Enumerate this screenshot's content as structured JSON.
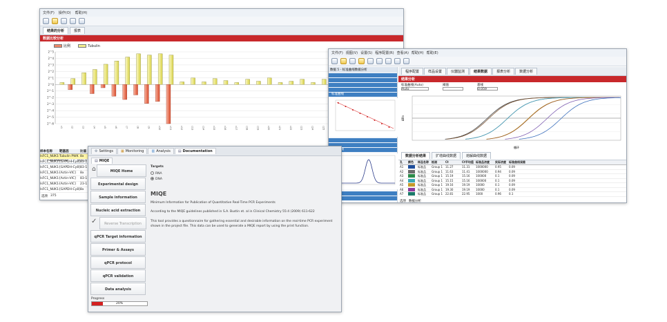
{
  "win1": {
    "menu": [
      "文件(F)",
      "操作(O)",
      "帮助(H)"
    ],
    "tabs": [
      "结果的分析",
      "报表"
    ],
    "section_title": "数据比较分析",
    "legend": [
      "比例",
      "Tubulin"
    ],
    "bottom_tabs": [
      "比较数据表格",
      "表达分析数据"
    ],
    "table_headers": [
      "样本名称",
      "靶基因",
      "比值"
    ],
    "rows": [
      [
        "IsFC1_NUK1-hp",
        "Tubulin PWK",
        "8x"
      ],
      [
        "IsFC1_NUK1-hp",
        "[GAPDH-Cy8]",
        "83-1"
      ],
      [
        "IsFC1_NUK1-hp",
        "[GAPDH-Cy8]",
        "83-1"
      ],
      [
        "IsFC1_NUK1-hp",
        "[Actin-VIC]",
        "8x"
      ],
      [
        "IsFC1_NUK1-hp",
        "[Actin-VIC]",
        "83-1"
      ],
      [
        "IsFC1_NUK1-hp",
        "[Actin-VIC]",
        "23-1"
      ],
      [
        "IsFC1_NUK1-hp",
        "[GAPDH-Cy8]",
        "8x"
      ]
    ],
    "footer": [
      "选项",
      "375"
    ]
  },
  "chart_data": {
    "type": "bar",
    "categories": [
      "c1",
      "c2",
      "c3",
      "c4",
      "c5",
      "c6",
      "c7",
      "c8",
      "c9",
      "c10",
      "c11",
      "c12",
      "c13",
      "c14",
      "c15",
      "c16",
      "c17",
      "c18",
      "c19",
      "c20",
      "c21",
      "c22",
      "c23",
      "c24",
      "c25",
      "c26",
      "c27",
      "c28",
      "c29",
      "c30",
      "c31"
    ],
    "ylim": [
      -6,
      5
    ],
    "yticks": [
      "2^5",
      "2^4",
      "2^3",
      "2^2",
      "2^1",
      "2^0",
      "2^-1",
      "2^-2",
      "2^-3",
      "2^-4",
      "2^-5",
      "2^-6"
    ],
    "series": [
      {
        "name": "比例",
        "values": [
          0,
          -0.8,
          0,
          -1.4,
          -0.5,
          -1.8,
          -2.3,
          -1.6,
          -2.9,
          -2.6,
          -6.0,
          0,
          0,
          0,
          0,
          0,
          0,
          0,
          0,
          0,
          0,
          0,
          0,
          0,
          0,
          0,
          0,
          0,
          0,
          0,
          0
        ]
      },
      {
        "name": "Tubulin",
        "values": [
          0.3,
          0.9,
          1.8,
          2.3,
          3.1,
          3.6,
          4.2,
          4.7,
          4.5,
          4.7,
          4.5,
          0.4,
          1.0,
          0.4,
          0.9,
          0.6,
          0.3,
          0.8,
          0.5,
          1.0,
          0.3,
          0.5,
          0.8,
          0.3,
          0.8,
          0.5,
          0.2,
          0.9,
          0.7,
          0.5,
          0.3
        ]
      }
    ],
    "grid": true,
    "legend": "top-left"
  },
  "win2": {
    "menu": [
      "文件(F)",
      "视图(V)",
      "设置(S)",
      "程序配置(R)",
      "查看(A)",
      "帮助(H)",
      "帮助(E)"
    ],
    "tabs": [
      "程序配置",
      "样品设置",
      "仪器监测",
      "结果数据",
      "报表分析",
      "数据分析"
    ],
    "panel_title": "数据 5 - 标准曲线数据分析",
    "section_title": "结果分析",
    "fields": [
      "标准曲线(Auto)",
      "阈值",
      "基线"
    ],
    "field_values": [
      "Auto",
      "0.059"
    ],
    "std_panel_title": "标准曲线",
    "melt_panel_title": "熔解曲线",
    "ylabel": "ΔRn",
    "xlabel": "循环",
    "result_tabs": [
      "数据分析结果",
      "扩增曲线数据",
      "熔解曲线数据"
    ],
    "table_headers": [
      "孔",
      "颜色",
      "样品名称",
      "检测",
      "Ct",
      "Ct平均值",
      "标准品浓度",
      "实际浓度",
      "标准曲线误差"
    ],
    "rows": [
      [
        "A1",
        "标准品",
        "Group 1",
        "11.27",
        "11.31",
        "1000000",
        "0.95",
        "0.09"
      ],
      [
        "A2",
        "标准品",
        "Group 1",
        "11.63",
        "11.41",
        "1000000",
        "0.94",
        "0.09"
      ],
      [
        "A3",
        "标准品",
        "Group 1",
        "15.19",
        "15.16",
        "100000",
        "0.1",
        "0.09"
      ],
      [
        "A4",
        "标准品",
        "Group 1",
        "15.15",
        "15.16",
        "100000",
        "0.1",
        "0.09"
      ],
      [
        "A5",
        "标准品",
        "Group 1",
        "19.16",
        "19.19",
        "10000",
        "0.1",
        "0.09"
      ],
      [
        "A6",
        "标准品",
        "Group 1",
        "19.30",
        "19.19",
        "10000",
        "0.1",
        "0.09"
      ],
      [
        "A7",
        "标准品",
        "Group 1",
        "22.81",
        "22.95",
        "1000",
        "0.96",
        "0.1"
      ]
    ],
    "row_colors": [
      "#1f4e9c",
      "#6c6c6c",
      "#2d8c4a",
      "#3aa9b5",
      "#c59b2a",
      "#8e3b9e",
      "#1b7a6a"
    ],
    "amp_colors": [
      "#3b3b3b",
      "#7a5230",
      "#2a7a4f",
      "#52a0c6",
      "#c9a33a",
      "#9b5c2c",
      "#7f5fb2",
      "#3b6fbc"
    ],
    "footer": [
      "选项",
      "数据分析"
    ]
  },
  "win3": {
    "tabs": [
      "Settings",
      "Monitoring",
      "Analysis",
      "Documentation"
    ],
    "subtab": "MIQE",
    "nav": [
      "MIQE Home",
      "Experimental design",
      "Sample information",
      "Nucleic acid extraction",
      "Reverse Transcription",
      "qPCR Target information",
      "Primer & Assays",
      "qPCR protocol",
      "qPCR validation",
      "Data analysis"
    ],
    "targets_label": "Targets",
    "radio": [
      "RNA",
      "DNA"
    ],
    "heading": "MIQE",
    "subtitle": "Minimum Information for Publication of Quantitative Real-Time PCR Experiments",
    "para1": "According to the MIQE guidelines published in S.A. Bustin et. al in Clinical Chemistry 55:4 (2009) 611-622",
    "para2": "This tool provides a questionnaire for gathering essential and desirable information on the real-time PCR experiment shown in the project file. This data can be used to generate a MIQE report by using the print function.",
    "progress_label": "Progress",
    "progress_text": "20%",
    "progress_value": 0.2
  }
}
